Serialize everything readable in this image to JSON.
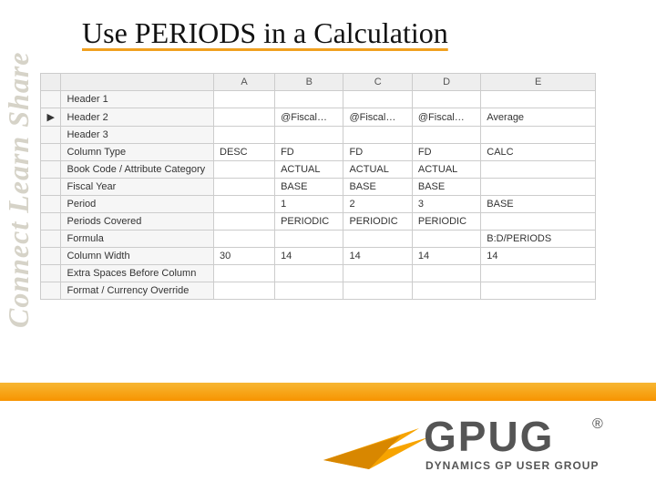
{
  "side_label": "Connect Learn Share",
  "title": "Use PERIODS in a Calculation",
  "columns": {
    "A": "A",
    "B": "B",
    "C": "C",
    "D": "D",
    "E": "E"
  },
  "row_labels": {
    "header1": "Header 1",
    "header2": "Header 2",
    "header3": "Header 3",
    "col_type": "Column Type",
    "book": "Book Code / Attribute Category",
    "fy": "Fiscal Year",
    "period": "Period",
    "periods_covered": "Periods Covered",
    "formula": "Formula",
    "col_width": "Column Width",
    "extra_spaces": "Extra Spaces Before Column",
    "fmt": "Format / Currency Override"
  },
  "cells": {
    "header1": {
      "A": "",
      "B": "",
      "C": "",
      "D": "",
      "E": ""
    },
    "header2": {
      "A": "",
      "B": "@Fiscal…",
      "C": "@Fiscal…",
      "D": "@Fiscal…",
      "E": "Average"
    },
    "header3": {
      "A": "",
      "B": "",
      "C": "",
      "D": "",
      "E": ""
    },
    "col_type": {
      "A": "DESC",
      "B": "FD",
      "C": "FD",
      "D": "FD",
      "E": "CALC"
    },
    "book": {
      "A": "",
      "B": "ACTUAL",
      "C": "ACTUAL",
      "D": "ACTUAL",
      "E": ""
    },
    "fy": {
      "A": "",
      "B": "BASE",
      "C": "BASE",
      "D": "BASE",
      "E": ""
    },
    "period": {
      "A": "",
      "B": "1",
      "C": "2",
      "D": "3",
      "E": "BASE"
    },
    "periods_covered": {
      "A": "",
      "B": "PERIODIC",
      "C": "PERIODIC",
      "D": "PERIODIC",
      "E": ""
    },
    "formula": {
      "A": "",
      "B": "",
      "C": "",
      "D": "",
      "E": "B:D/PERIODS"
    },
    "col_width": {
      "A": "30",
      "B": "14",
      "C": "14",
      "D": "14",
      "E": "14"
    },
    "extra_spaces": {
      "A": "",
      "B": "",
      "C": "",
      "D": "",
      "E": ""
    },
    "fmt": {
      "A": "",
      "B": "",
      "C": "",
      "D": "",
      "E": ""
    }
  },
  "indicator": "▶",
  "logo": {
    "top": "GPUG",
    "reg": "®",
    "sub": "DYNAMICS GP USER GROUP"
  }
}
